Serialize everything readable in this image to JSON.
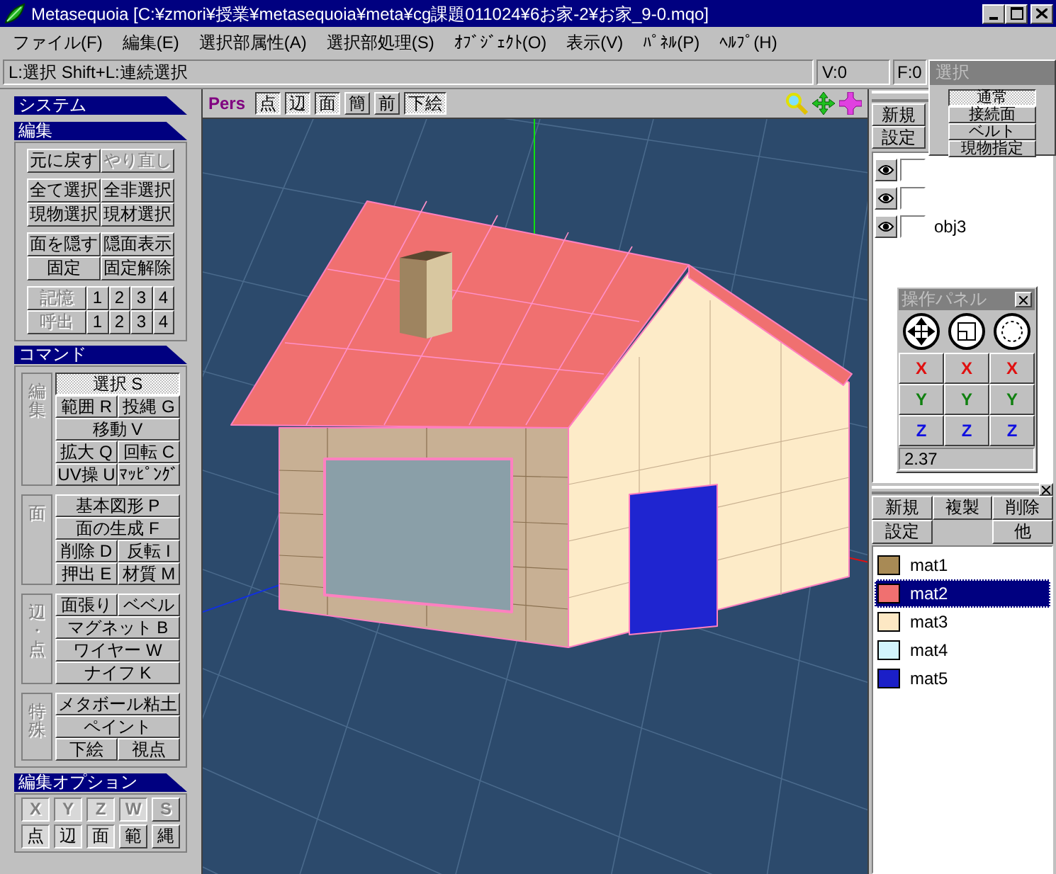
{
  "window": {
    "title": "Metasequoia [C:¥zmori¥授業¥metasequoia¥meta¥cg課題011024¥6お家-2¥お家_9-0.mqo]"
  },
  "menu": [
    "ファイル(F)",
    "編集(E)",
    "選択部属性(A)",
    "選択部処理(S)",
    "ｵﾌﾞｼﾞｪｸﾄ(O)",
    "表示(V)",
    "ﾊﾟﾈﾙ(P)",
    "ﾍﾙﾌﾟ(H)"
  ],
  "status_bar": {
    "hint": "L:選択  Shift+L:連続選択",
    "vertex_count": "V:0",
    "face_count": "F:0"
  },
  "system_section": {
    "title": "システム"
  },
  "edit_section": {
    "title": "編集",
    "groups": [
      [
        [
          {
            "label": "元に戻す",
            "disabled": false
          },
          {
            "label": "やり直し",
            "disabled": true
          }
        ]
      ],
      [
        [
          {
            "label": "全て選択",
            "disabled": false
          },
          {
            "label": "全非選択",
            "disabled": false
          }
        ],
        [
          {
            "label": "現物選択",
            "disabled": false
          },
          {
            "label": "現材選択",
            "disabled": false
          }
        ]
      ],
      [
        [
          {
            "label": "面を隠す",
            "disabled": false
          },
          {
            "label": "隠面表示",
            "disabled": false
          }
        ],
        [
          {
            "label": "固定",
            "disabled": false
          },
          {
            "label": "固定解除",
            "disabled": false
          }
        ]
      ]
    ],
    "memory": [
      {
        "label": "記憶",
        "disabled": true,
        "slots": [
          "1",
          "2",
          "3",
          "4"
        ]
      },
      {
        "label": "呼出",
        "disabled": true,
        "slots": [
          "1",
          "2",
          "3",
          "4"
        ]
      }
    ]
  },
  "command_section": {
    "title": "コマンド",
    "groups": [
      {
        "label": "編集",
        "rows": [
          [
            {
              "label": "選択 S",
              "selected": true
            }
          ],
          [
            {
              "label": "範囲 R",
              "selected": false
            },
            {
              "label": "投縄 G",
              "selected": false
            }
          ],
          [
            {
              "label": "移動 V",
              "selected": false
            }
          ],
          [
            {
              "label": "拡大 Q",
              "selected": false
            },
            {
              "label": "回転 C",
              "selected": false
            }
          ],
          [
            {
              "label": "UV操 U",
              "selected": false
            },
            {
              "label": "ﾏｯﾋﾟﾝｸﾞ",
              "selected": false
            }
          ]
        ]
      },
      {
        "label": "面",
        "rows": [
          [
            {
              "label": "基本図形 P",
              "selected": false
            }
          ],
          [
            {
              "label": "面の生成 F",
              "selected": false
            }
          ],
          [
            {
              "label": "削除 D",
              "selected": false
            },
            {
              "label": "反転 I",
              "selected": false
            }
          ],
          [
            {
              "label": "押出 E",
              "selected": false
            },
            {
              "label": "材質 M",
              "selected": false
            }
          ]
        ]
      },
      {
        "label": "辺・点",
        "rows": [
          [
            {
              "label": "面張り",
              "selected": false
            },
            {
              "label": "ベベル",
              "selected": false
            }
          ],
          [
            {
              "label": "マグネット B",
              "selected": false
            }
          ],
          [
            {
              "label": "ワイヤー W",
              "selected": false
            }
          ],
          [
            {
              "label": "ナイフ K",
              "selected": false
            }
          ]
        ]
      },
      {
        "label": "特殊",
        "rows": [
          [
            {
              "label": "メタボール粘土",
              "selected": false
            }
          ],
          [
            {
              "label": "ペイント",
              "selected": false
            }
          ],
          [
            {
              "label": "下絵",
              "selected": false
            },
            {
              "label": "視点",
              "selected": false
            }
          ]
        ]
      }
    ]
  },
  "options_section": {
    "title": "編集オプション",
    "rows": [
      [
        {
          "label": "X",
          "selected": true,
          "disabled": true
        },
        {
          "label": "Y",
          "selected": true,
          "disabled": true
        },
        {
          "label": "Z",
          "selected": true,
          "disabled": true
        },
        {
          "label": "W",
          "selected": true,
          "disabled": true
        },
        {
          "label": "S",
          "selected": false,
          "disabled": true
        }
      ],
      [
        {
          "label": "点",
          "selected": true,
          "disabled": false
        },
        {
          "label": "辺",
          "selected": true,
          "disabled": false
        },
        {
          "label": "面",
          "selected": true,
          "disabled": false
        },
        {
          "label": "範",
          "selected": false,
          "disabled": false
        },
        {
          "label": "縄",
          "selected": false,
          "disabled": false
        }
      ]
    ]
  },
  "viewport": {
    "view_mode": "Pers",
    "buttons": [
      {
        "label": "点",
        "selected": true
      },
      {
        "label": "辺",
        "selected": true
      },
      {
        "label": "面",
        "selected": true
      },
      {
        "label": "簡",
        "selected": false
      },
      {
        "label": "前",
        "selected": false
      },
      {
        "label": "下絵",
        "selected": true
      }
    ]
  },
  "object_panel": {
    "buttons": [
      "新規",
      "設定"
    ],
    "objects": [
      {
        "visible": true
      },
      {
        "visible": true
      },
      {
        "visible": true,
        "name": "obj3"
      }
    ]
  },
  "selection_panel": {
    "title": "選択",
    "modes": [
      {
        "label": "通常",
        "selected": true
      },
      {
        "label": "接続面",
        "selected": false
      },
      {
        "label": "ベルト",
        "selected": false
      },
      {
        "label": "現物指定",
        "selected": false
      }
    ]
  },
  "operation_panel": {
    "title": "操作パネル",
    "axes": [
      {
        "label": "X",
        "color": "#e01010"
      },
      {
        "label": "X",
        "color": "#e01010"
      },
      {
        "label": "X",
        "color": "#e01010"
      },
      {
        "label": "Y",
        "color": "#108010"
      },
      {
        "label": "Y",
        "color": "#108010"
      },
      {
        "label": "Y",
        "color": "#108010"
      },
      {
        "label": "Z",
        "color": "#1010e0"
      },
      {
        "label": "Z",
        "color": "#1010e0"
      },
      {
        "label": "Z",
        "color": "#1010e0"
      }
    ],
    "value": "2.37"
  },
  "material_panel": {
    "buttons": [
      "新規",
      "複製",
      "削除",
      "設定",
      "他"
    ],
    "materials": [
      {
        "name": "mat1",
        "color": "#a88a55",
        "selected": false
      },
      {
        "name": "mat2",
        "color": "#f07070",
        "selected": true
      },
      {
        "name": "mat3",
        "color": "#fde8c4",
        "selected": false
      },
      {
        "name": "mat4",
        "color": "#d2f4fc",
        "selected": false
      },
      {
        "name": "mat5",
        "color": "#1b1fc8",
        "selected": false
      }
    ]
  }
}
